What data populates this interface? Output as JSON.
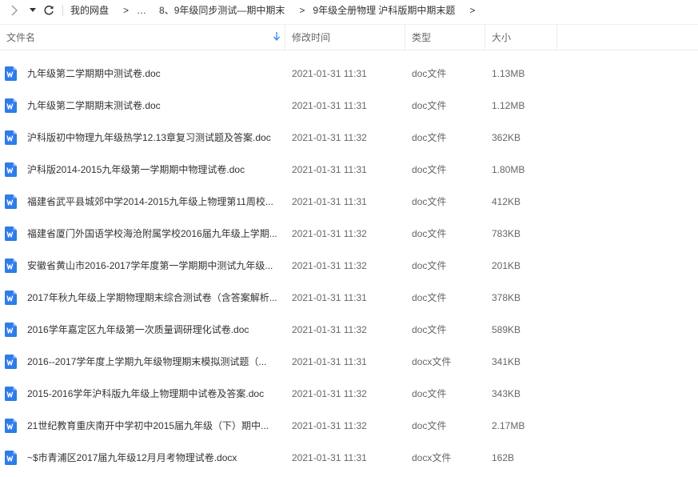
{
  "toolbar": {
    "back_icon": "chevron-right-icon",
    "dropdown_icon": "caret-down-icon",
    "refresh_icon": "refresh-icon"
  },
  "breadcrumb": {
    "items": [
      "我的网盘",
      "…",
      "8、9年级同步测试—期中期末",
      "9年级全册物理 沪科版期中期末题"
    ],
    "separator": ">"
  },
  "columns": {
    "name": "文件名",
    "modified": "修改时间",
    "type": "类型",
    "size": "大小"
  },
  "files": [
    {
      "name": "九年级第二学期期中测试卷.doc",
      "time": "2021-01-31 11:31",
      "type": "doc文件",
      "size": "1.13MB",
      "icon": "word-doc-icon"
    },
    {
      "name": "九年级第二学期期末测试卷.doc",
      "time": "2021-01-31 11:31",
      "type": "doc文件",
      "size": "1.12MB",
      "icon": "word-doc-icon"
    },
    {
      "name": "沪科版初中物理九年级热学12.13章复习测试题及答案.doc",
      "time": "2021-01-31 11:32",
      "type": "doc文件",
      "size": "362KB",
      "icon": "word-doc-icon"
    },
    {
      "name": "沪科版2014-2015九年级第一学期期中物理试卷.doc",
      "time": "2021-01-31 11:31",
      "type": "doc文件",
      "size": "1.80MB",
      "icon": "word-doc-icon"
    },
    {
      "name": "福建省武平县城郊中学2014-2015九年级上物理第11周校...",
      "time": "2021-01-31 11:31",
      "type": "doc文件",
      "size": "412KB",
      "icon": "word-doc-icon"
    },
    {
      "name": "福建省厦门外国语学校海沧附属学校2016届九年级上学期...",
      "time": "2021-01-31 11:32",
      "type": "doc文件",
      "size": "783KB",
      "icon": "word-doc-icon"
    },
    {
      "name": "安徽省黄山市2016-2017学年度第一学期期中测试九年级...",
      "time": "2021-01-31 11:32",
      "type": "doc文件",
      "size": "201KB",
      "icon": "word-doc-icon"
    },
    {
      "name": "2017年秋九年级上学期物理期末综合测试卷（含答案解析...",
      "time": "2021-01-31 11:31",
      "type": "doc文件",
      "size": "378KB",
      "icon": "word-doc-icon"
    },
    {
      "name": "2016学年嘉定区九年级第一次质量调研理化试卷.doc",
      "time": "2021-01-31 11:32",
      "type": "doc文件",
      "size": "589KB",
      "icon": "word-doc-icon"
    },
    {
      "name": "2016--2017学年度上学期九年级物理期末模拟测试题（...",
      "time": "2021-01-31 11:31",
      "type": "docx文件",
      "size": "341KB",
      "icon": "word-doc-icon"
    },
    {
      "name": "2015-2016学年沪科版九年级上物理期中试卷及答案.doc",
      "time": "2021-01-31 11:32",
      "type": "doc文件",
      "size": "343KB",
      "icon": "word-doc-icon"
    },
    {
      "name": "21世纪教育重庆南开中学初中2015届九年级（下）期中...",
      "time": "2021-01-31 11:32",
      "type": "doc文件",
      "size": "2.17MB",
      "icon": "word-doc-icon"
    },
    {
      "name": "~$市青浦区2017届九年级12月月考物理试卷.docx",
      "time": "2021-01-31 11:31",
      "type": "docx文件",
      "size": "162B",
      "icon": "word-doc-icon"
    }
  ],
  "colors": {
    "word_icon": "#2f7ce8",
    "sort_arrow": "#3b8cff",
    "divider": "#ececec"
  }
}
